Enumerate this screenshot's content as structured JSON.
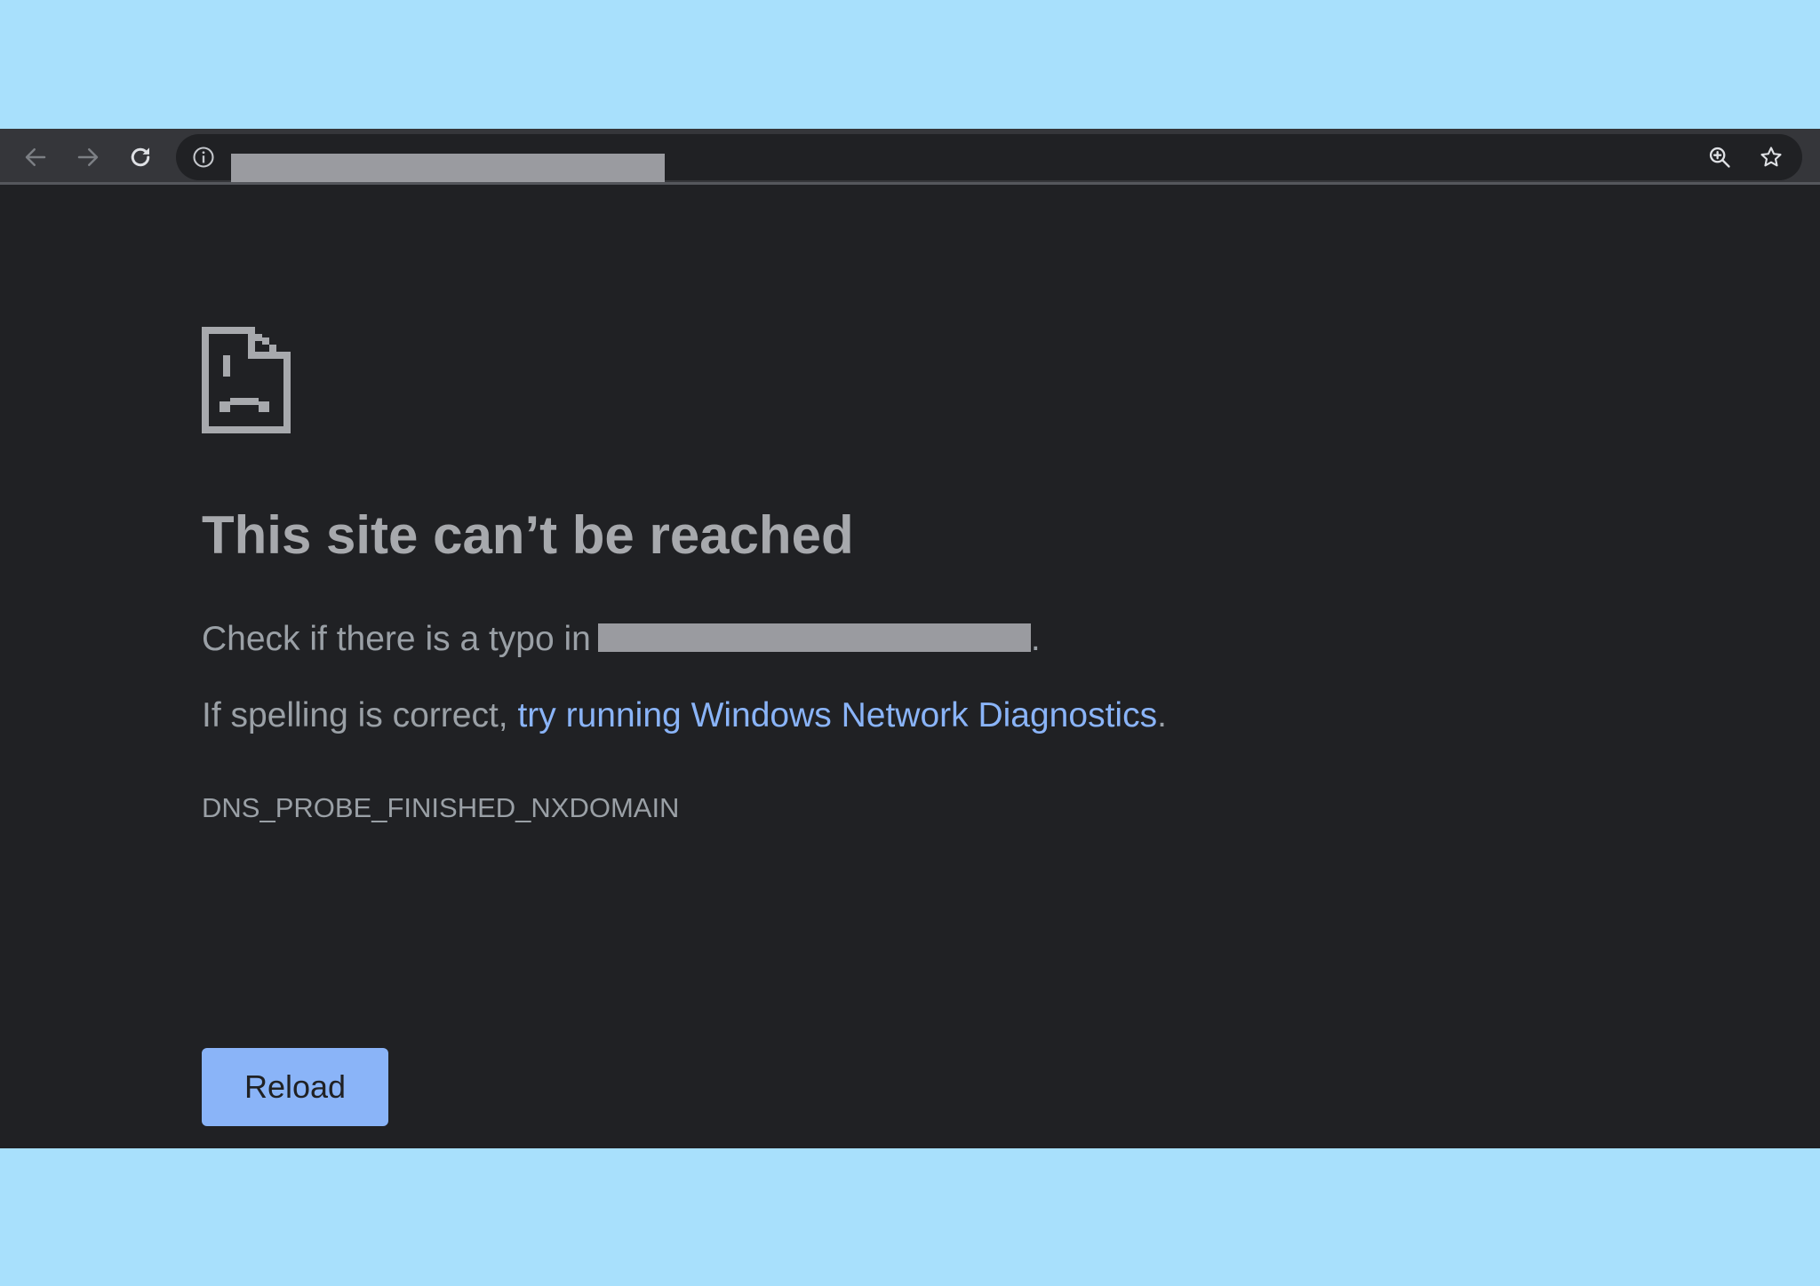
{
  "colors": {
    "backdrop": "#a8e0fc",
    "page_bg": "#202124",
    "toolbar_bg": "#35363a",
    "title_text": "#a7a9ad",
    "body_text": "#9aa0a6",
    "link": "#8ab4f8",
    "button_bg": "#8ab4f8",
    "redaction": "#9a9ba0"
  },
  "toolbar": {
    "back_icon": "arrow-left",
    "forward_icon": "arrow-right",
    "reload_icon": "refresh",
    "site_info_icon": "info-circle",
    "zoom_icon": "magnifier-plus",
    "bookmark_icon": "star-outline",
    "url_redacted": true
  },
  "error_page": {
    "icon": "sad-document",
    "title": "This site can’t be reached",
    "typo_text": "Check if there is a typo in",
    "typo_period": ".",
    "hostname_redacted": true,
    "spelling_text": "If spelling is correct, ",
    "diagnostics_link": "try running Windows Network Diagnostics",
    "spelling_period": ".",
    "error_code": "DNS_PROBE_FINISHED_NXDOMAIN",
    "reload_button": "Reload"
  }
}
